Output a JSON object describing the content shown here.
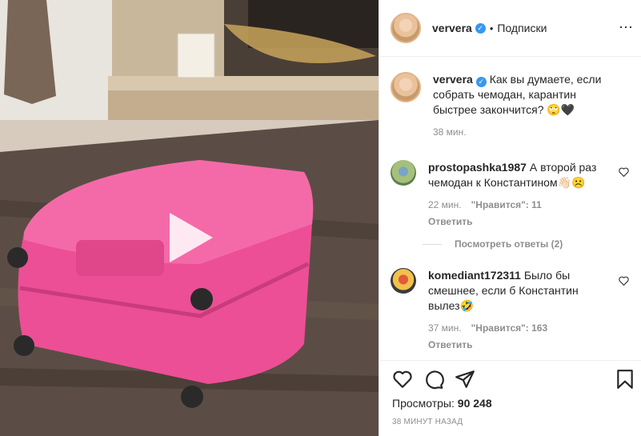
{
  "header": {
    "username": "ververa",
    "separator": "•",
    "follow_label": "Подписки",
    "more_icon": "ellipsis-icon"
  },
  "caption": {
    "username": "ververa",
    "text": "Как вы думаете, если собрать чемодан, карантин быстрее закончится? 🙄🖤",
    "time": "38 мин."
  },
  "comments": [
    {
      "username": "prostopashka1987",
      "text": "А второй раз чемодан к Константином👋🏻☹️",
      "time": "22 мин.",
      "likes": "\"Нравится\": 11",
      "reply_label": "Ответить"
    },
    {
      "username": "komediant172311",
      "text": "Было бы смешнее, если б Константин вылез🤣",
      "time": "37 мин.",
      "likes": "\"Нравится\": 163",
      "reply_label": "Ответить"
    }
  ],
  "view_replies_label": "Посмотреть ответы (2)",
  "actions": {
    "views_label": "Просмотры:",
    "views_count": "90 248",
    "time_ago": "38 МИНУТ НАЗАД"
  },
  "colors": {
    "suitcase": "#f0559a",
    "verified": "#3897f0",
    "muted_text": "#8e8e8e"
  }
}
